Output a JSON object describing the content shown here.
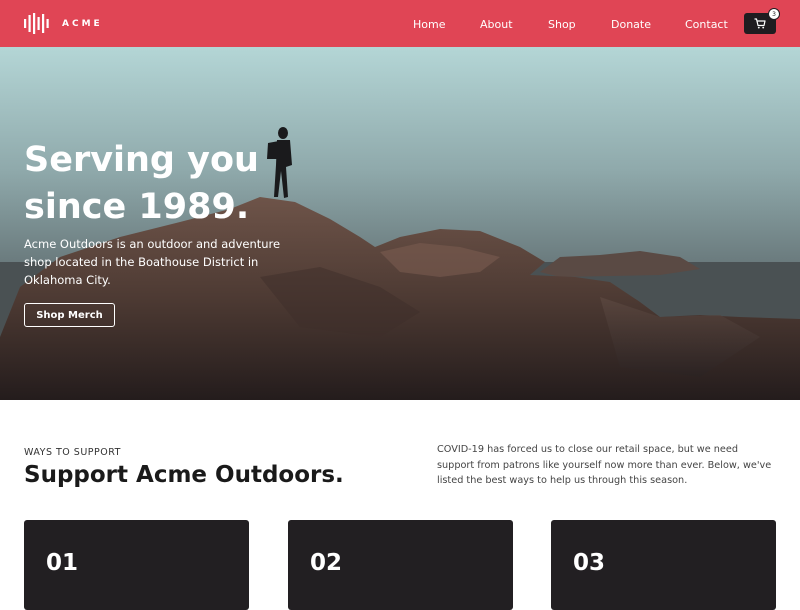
{
  "header": {
    "brand": "ACME",
    "nav": [
      "Home",
      "About",
      "Shop",
      "Donate",
      "Contact"
    ],
    "cart_count": "3",
    "colors": {
      "background": "#e04555",
      "cart": "#1f1c20"
    }
  },
  "hero": {
    "title_line1": "Serving you",
    "title_line2": "since 1989.",
    "description": "Acme Outdoors is an outdoor and adventure shop located in the Boathouse District in Oklahoma City.",
    "cta_label": "Shop Merch"
  },
  "support": {
    "eyebrow": "WAYS TO SUPPORT",
    "title": "Support Acme Outdoors.",
    "description": "COVID-19 has forced us to close our retail space, but we need support from patrons like yourself now more than ever. Below, we've listed the best ways to help us through this season.",
    "cards": [
      {
        "number": "01"
      },
      {
        "number": "02"
      },
      {
        "number": "03"
      }
    ]
  }
}
